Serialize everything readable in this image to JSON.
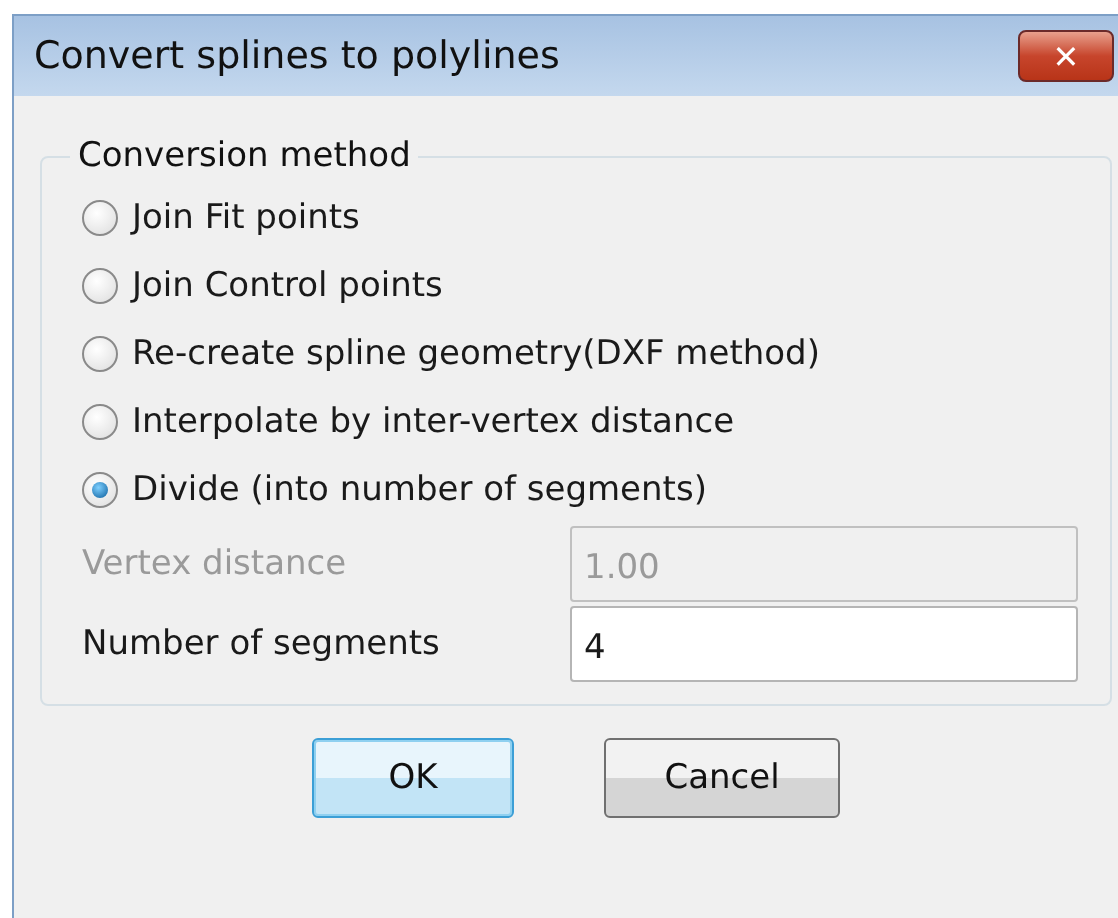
{
  "window": {
    "title": "Convert splines to polylines",
    "close": "✕"
  },
  "group": {
    "legend": "Conversion method",
    "options": [
      {
        "label": "Join Fit points",
        "selected": false
      },
      {
        "label": "Join Control points",
        "selected": false
      },
      {
        "label": "Re-create spline geometry(DXF method)",
        "selected": false
      },
      {
        "label": "Interpolate by inter-vertex distance",
        "selected": false
      },
      {
        "label": "Divide (into number of segments)",
        "selected": true
      }
    ],
    "fields": [
      {
        "label": "Vertex distance",
        "value": "1.00",
        "disabled": true
      },
      {
        "label": "Number of segments",
        "value": "4",
        "disabled": false
      }
    ]
  },
  "buttons": [
    {
      "label": "OK",
      "default": true
    },
    {
      "label": "Cancel",
      "default": false
    }
  ]
}
